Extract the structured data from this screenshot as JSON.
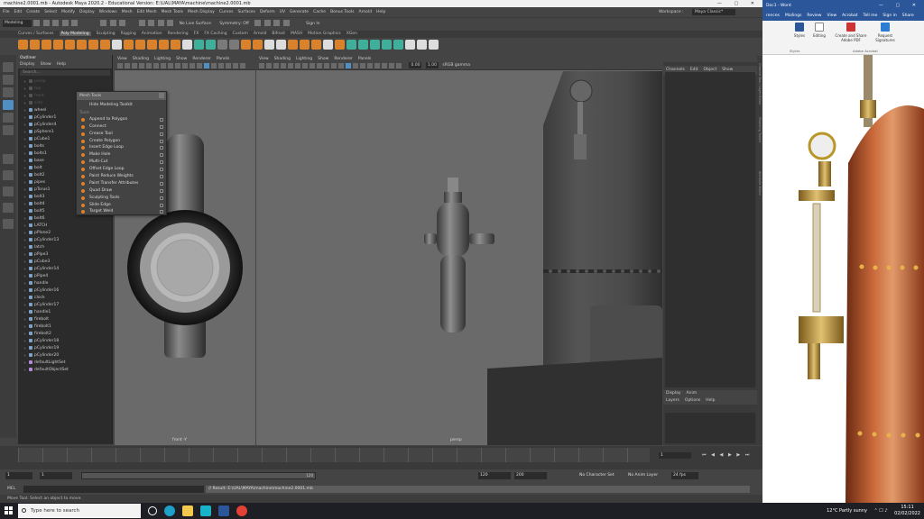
{
  "maya": {
    "title": "machine2.0001.mb - Autodesk Maya 2020.2 - Educational Version: E:\\UAL\\MAYA\\machine\\machine2.0001.mb",
    "menus": [
      "File",
      "Edit",
      "Create",
      "Select",
      "Modify",
      "Display",
      "Windows",
      "Mesh",
      "Edit Mesh",
      "Mesh Tools",
      "Mesh Display",
      "Curves",
      "Surfaces",
      "Deform",
      "UV",
      "Generate",
      "Cache",
      "Bonus Tools",
      "Arnold",
      "Help"
    ],
    "workspace_label": "Workspace :",
    "workspace_value": "Maya Classic*",
    "mode": "Modeling",
    "no_live_surface": "No Live Surface",
    "symmetry": "Symmetry: Off",
    "sign_in": "Sign In",
    "shelf_tabs": [
      "Curves / Surfaces",
      "Poly Modeling",
      "Sculpting",
      "Rigging",
      "Animation",
      "Rendering",
      "FX",
      "FX Caching",
      "Custom",
      "Arnold",
      "Bifrost",
      "MASH",
      "Motion Graphics",
      "XGen"
    ],
    "active_shelf": "Poly Modeling",
    "outliner": {
      "title": "Outliner",
      "menu": [
        "Display",
        "Show",
        "Help"
      ],
      "search_placeholder": "Search...",
      "items": [
        {
          "label": "persp",
          "dim": true
        },
        {
          "label": "top",
          "dim": true
        },
        {
          "label": "front",
          "dim": true
        },
        {
          "label": "side",
          "dim": true
        },
        {
          "label": "wheel"
        },
        {
          "label": "pCylinder1"
        },
        {
          "label": "pCylinder4"
        },
        {
          "label": "pSphere1"
        },
        {
          "label": "pCube1"
        },
        {
          "label": "bolts"
        },
        {
          "label": "bolts1"
        },
        {
          "label": "base"
        },
        {
          "label": "bolt"
        },
        {
          "label": "bolt2"
        },
        {
          "label": "pipes"
        },
        {
          "label": "pTorus1"
        },
        {
          "label": "bolt3"
        },
        {
          "label": "bolt4"
        },
        {
          "label": "bolt5"
        },
        {
          "label": "bolt6"
        },
        {
          "label": "LATCH"
        },
        {
          "label": "pPlane2"
        },
        {
          "label": "pCylinder13"
        },
        {
          "label": "latch"
        },
        {
          "label": "pPipe3"
        },
        {
          "label": "pCube3"
        },
        {
          "label": "pCylinder14"
        },
        {
          "label": "pPipe4"
        },
        {
          "label": "handle"
        },
        {
          "label": "pCylinder16"
        },
        {
          "label": "clock"
        },
        {
          "label": "pCylinder17"
        },
        {
          "label": "handle1"
        },
        {
          "label": "firebolt"
        },
        {
          "label": "firebolt1"
        },
        {
          "label": "firebolt2"
        },
        {
          "label": "pCylinder18"
        },
        {
          "label": "pCylinder19"
        },
        {
          "label": "pCylinder20"
        },
        {
          "label": "defaultLightSet",
          "set": true
        },
        {
          "label": "defaultObjectSet",
          "set": true
        }
      ]
    },
    "viewport_menu": [
      "View",
      "Shading",
      "Lighting",
      "Show",
      "Renderer",
      "Panels"
    ],
    "viewport_front_label": "front -Y",
    "viewport_persp_label": "persp",
    "cam_values": [
      "0.00",
      "1.00"
    ],
    "color_space": "sRGB gamma",
    "mesh_tools": {
      "title": "Mesh Tools",
      "hide_label": "Hide Modeling Toolkit",
      "section": "Tools",
      "items": [
        "Append to Polygon",
        "Connect",
        "Crease Tool",
        "Create Polygon",
        "Insert Edge Loop",
        "Make Hole",
        "Multi-Cut",
        "Offset Edge Loop",
        "Paint Reduce Weights",
        "Paint Transfer Attributes",
        "Quad Draw",
        "Sculpting Tools",
        "Slide Edge",
        "Target Weld"
      ]
    },
    "channel_box": {
      "menu": [
        "Channels",
        "Edit",
        "Object",
        "Show"
      ],
      "layer_tabs": [
        "Display",
        "Anim"
      ],
      "layer_menu": [
        "Layers",
        "Options",
        "Help"
      ]
    },
    "side_tabs": [
      "Channel Box / Layer Editor",
      "Modeling Toolkit",
      "Attribute Editor"
    ],
    "time": {
      "current_frame": "1",
      "range_start": "1",
      "range_inner_start": "1",
      "range_end": "120",
      "anim_end": "120",
      "anim_end2": "200",
      "fps": "24 fps",
      "char_set": "No Character Set",
      "anim_layer": "No Anim Layer"
    },
    "cmd_label": "MEL",
    "result_text": "// Result: E:\\UAL\\MAYA\\machine\\machine2.0001.mb",
    "help_text": "Move Tool: Select an object to move."
  },
  "word": {
    "title": "Doc1 - Word",
    "tabs": [
      "rences",
      "Mailings",
      "Review",
      "View",
      "Acrobat",
      "Tell me",
      "Sign in",
      "Share"
    ],
    "ribbon": [
      {
        "label": "Styles"
      },
      {
        "label": "Editing"
      },
      {
        "label": "Create and Share Adobe PDF"
      },
      {
        "label": "Request Signatures"
      }
    ],
    "group_labels": [
      "Styles",
      "Adobe Acrobat"
    ]
  },
  "taskbar": {
    "search_placeholder": "Type here to search",
    "weather": "12°C  Partly sunny",
    "time": "15:11",
    "date": "02/02/2022"
  }
}
